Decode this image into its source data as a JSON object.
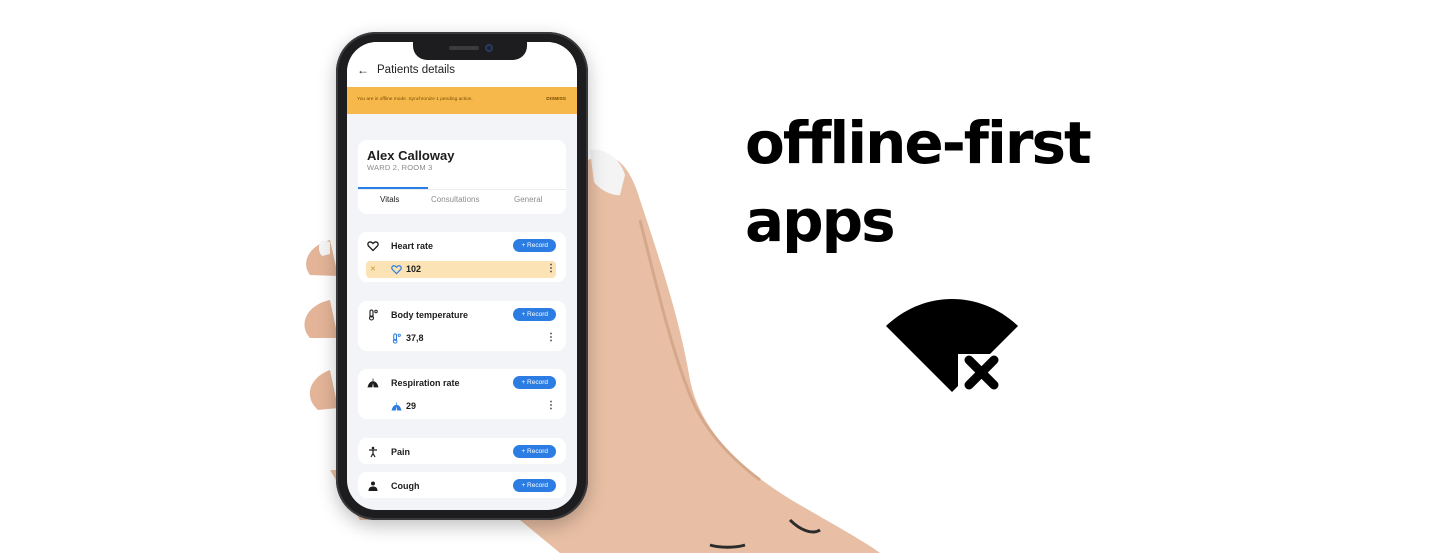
{
  "app": {
    "header_title": "Patients details",
    "offline_banner": {
      "message": "You are in offline mode. Synchronize 1 pending action.",
      "dismiss_label": "DISMISS"
    },
    "patient": {
      "name": "Alex Calloway",
      "ward": "WARD 2, ROOM 3"
    },
    "tabs": [
      {
        "label": "Vitals",
        "active": true
      },
      {
        "label": "Consultations",
        "active": false
      },
      {
        "label": "General",
        "active": false
      }
    ],
    "vitals": [
      {
        "label": "Heart rate",
        "icon": "heart-icon",
        "record_label": "+ Record",
        "value": "102",
        "pending": true
      },
      {
        "label": "Body temperature",
        "icon": "thermometer-icon",
        "record_label": "+ Record",
        "value": "37,8",
        "pending": false
      },
      {
        "label": "Respiration rate",
        "icon": "lungs-icon",
        "record_label": "+ Record",
        "value": "29",
        "pending": false
      },
      {
        "label": "Pain",
        "icon": "person-icon",
        "record_label": "+ Record"
      },
      {
        "label": "Cough",
        "icon": "cough-icon",
        "record_label": "+ Record"
      }
    ]
  },
  "headline": {
    "line1": "offline-first",
    "line2": "apps"
  },
  "icons": {
    "offline": "wifi-off-icon"
  },
  "colors": {
    "accent": "#2b7de3",
    "banner": "#f6b84b",
    "pending_row": "#fbe3b5"
  }
}
